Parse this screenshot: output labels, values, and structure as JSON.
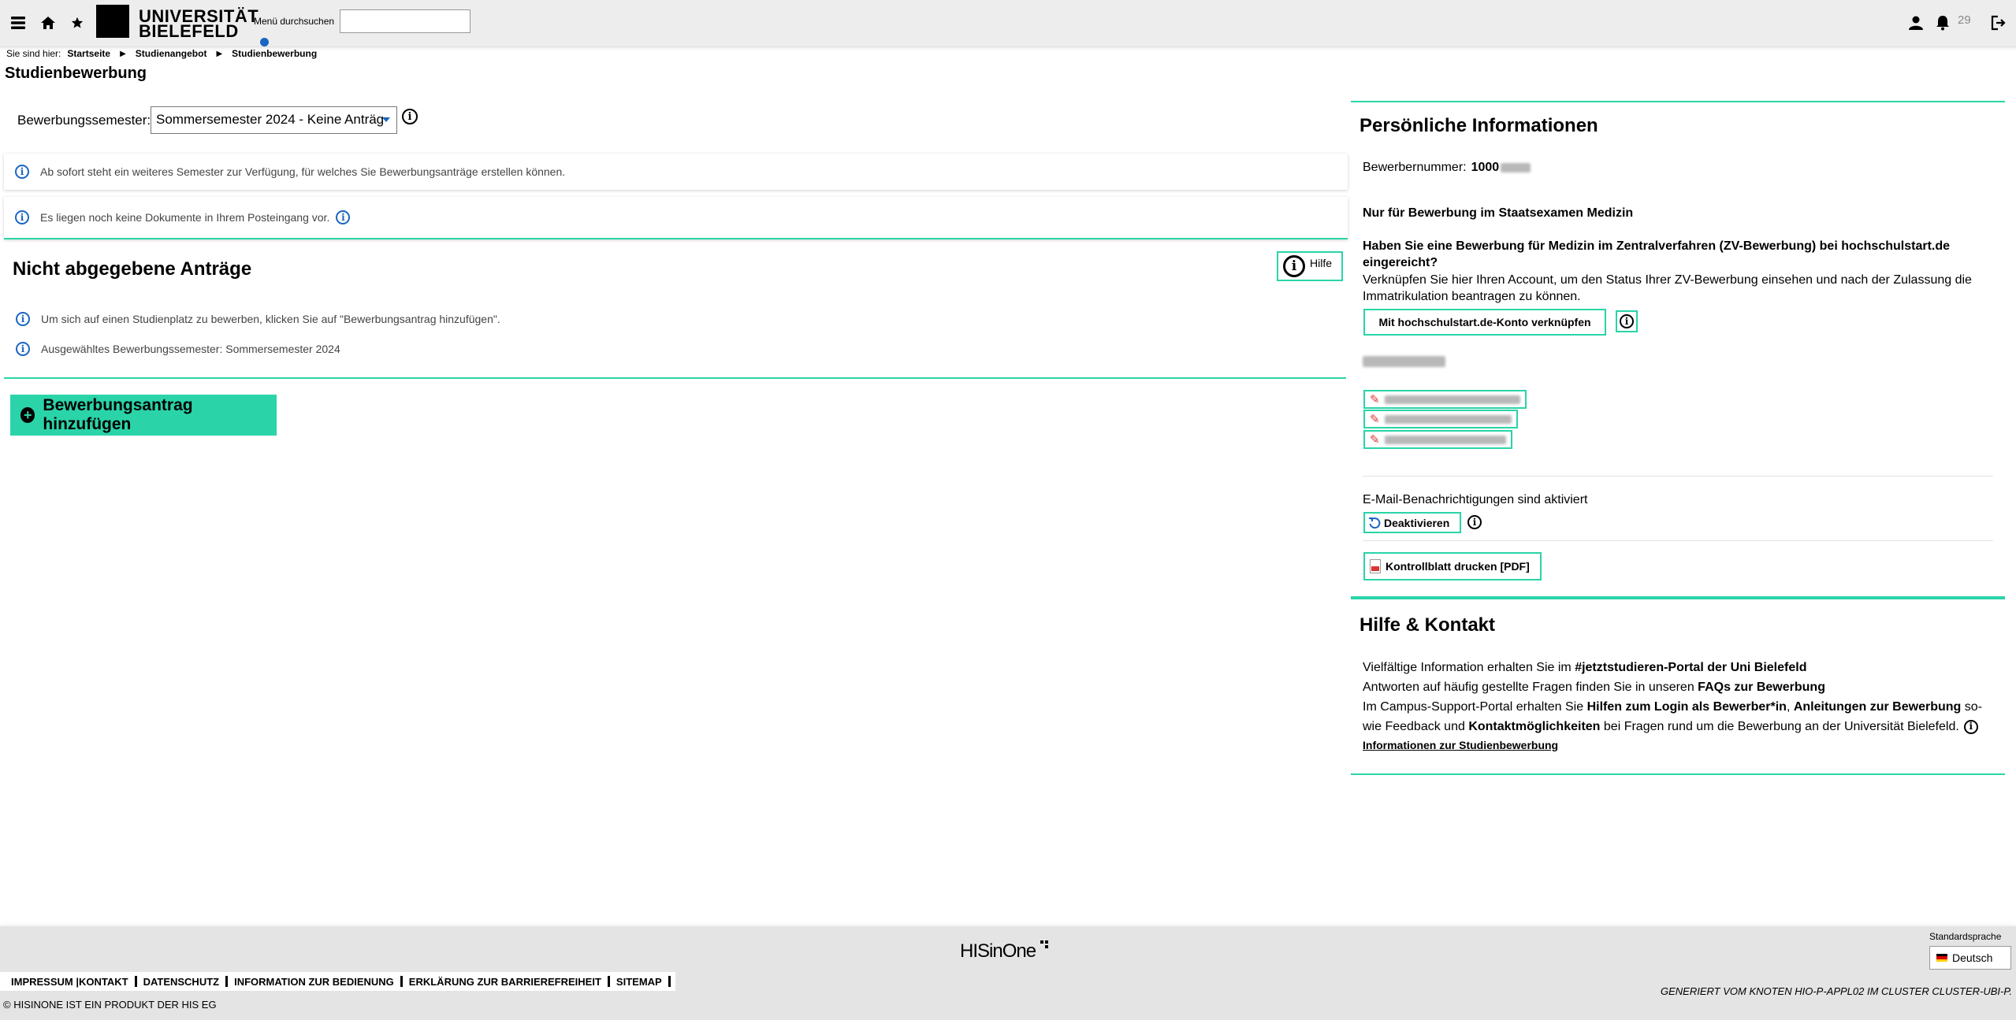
{
  "header": {
    "logo_text_line1": "UNIVERSITÄT",
    "logo_text_line2": "BIELEFELD",
    "menu_search_label": "Menü durchsuchen",
    "menu_search_value": "",
    "notification_count": "29",
    "icons": [
      "menu-icon",
      "home-icon",
      "star-icon",
      "user-icon",
      "bell-icon",
      "logout-icon"
    ]
  },
  "breadcrumb": {
    "prefix": "Sie sind hier:",
    "items": [
      "Startseite",
      "Studienangebot",
      "Studienbewerbung"
    ]
  },
  "page_title": "Studienbewerbung",
  "semester": {
    "label": "Bewerbungssemester:",
    "selected": "Sommersemester 2024 - Keine Anträg"
  },
  "info_messages": {
    "new_semester": "Ab sofort steht ein weiteres Semester zur Verfügung, für welches Sie Bewerbungsanträge erstellen können.",
    "no_documents": "Es liegen noch keine Dokumente in Ihrem Posteingang vor."
  },
  "applications": {
    "heading": "Nicht abgegebene Anträge",
    "help_label": "Hilfe",
    "hint1": "Um sich auf einen Studienplatz zu bewerben, klicken Sie auf \"Bewerbungsantrag hinzufügen\".",
    "hint2": "Ausgewähltes Bewerbungssemester: Sommersemester 2024",
    "add_button": "Bewerbungsantrag hinzufügen"
  },
  "personal": {
    "heading": "Persönliche Informationen",
    "applicant_number_label": "Bewerbernummer:",
    "applicant_number_visible": "1000",
    "medizin_heading": "Nur für Bewerbung im Staatsexamen Medizin",
    "zv_question": "Haben Sie eine Bewerbung für Medizin im Zentralverfahren (ZV-Bewerbung) bei hochschulstart.de eingereicht?",
    "zv_text": "Verknüpfen Sie hier Ihren Account, um den Status Ihrer ZV-Bewerbung einsehen und nach der Zulassung die Immatrikulation beantragen zu können.",
    "link_button": "Mit hochschulstart.de-Konto verknüpfen",
    "email_status": "E-Mail-Benachrichtigungen sind aktiviert",
    "deactivate_button": "Deaktivieren",
    "pdf_button": "Kontrollblatt drucken [PDF]"
  },
  "help_contact": {
    "heading": "Hilfe & Kontakt",
    "line1_pre": "Vielfältige Information erhalten Sie im ",
    "line1_link": "#jetztstudieren-Portal der Uni Bielefeld",
    "line2_pre": "Antworten auf häufig gestellte Fragen finden Sie in unseren ",
    "line2_link": "FAQs zur Bewerbung",
    "line3_pre": "Im Campus-Support-Portal erhalten Sie ",
    "line3_link1": "Hilfen zum Login als Bewerber*in",
    "line3_mid": ", ",
    "line3_link2": "Anleitungen zur Bewerbung",
    "line3_post": " so-wie Feedback und ",
    "line3_link3": "Kontaktmöglichkeiten",
    "line3_end": " bei Fragen rund um die Bewerbung an der Universität Bielefeld.",
    "info_link": "Informationen zur Studienbewerbung"
  },
  "footer": {
    "logo": "HISinOne",
    "language_label": "Standardsprache",
    "language": "Deutsch",
    "links": [
      "IMPRESSUM |KONTAKT",
      "DATENSCHUTZ",
      "INFORMATION ZUR BEDIENUNG",
      "ERKLÄRUNG ZUR BARRIEREFREIHEIT",
      "SITEMAP"
    ],
    "copyright": "© HISINONE IST EIN PRODUKT DER HIS EG",
    "generated": "GENERIERT VOM KNOTEN HIO-P-APPL02 IM CLUSTER CLUSTER-UBI-P."
  },
  "colors": {
    "accent": "#2ad4a8",
    "info_blue": "#1a66c2",
    "header_bg": "#ededed",
    "footer_bg": "#e4e4e4"
  }
}
